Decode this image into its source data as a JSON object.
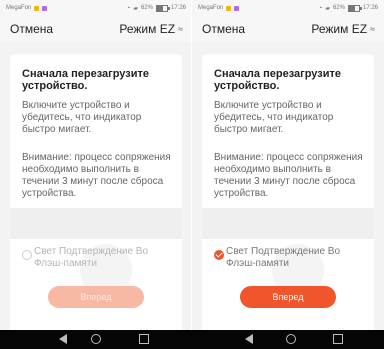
{
  "screens": [
    {
      "status": {
        "carrier": "MegaFon",
        "battery": "62%",
        "time": "17:26"
      },
      "header": {
        "cancel_label": "Отмена",
        "mode_label": "Режим EZ"
      },
      "card": {
        "title": "Сначала перезагрузите устройство.",
        "instruction": "Включите устройство и убедитесь, что индикатор быстро мигает.",
        "warning": "Внимание: процесс сопряжения необходимо выполнить в течении 3 минут после сброса устройства.",
        "confirm_label": "Свет Подтверждение Во Флэш-памяти",
        "confirm_checked": false,
        "next_label": "Вперед",
        "next_enabled": false
      }
    },
    {
      "status": {
        "carrier": "MegaFon",
        "battery": "62%",
        "time": "17:26"
      },
      "header": {
        "cancel_label": "Отмена",
        "mode_label": "Режим EZ"
      },
      "card": {
        "title": "Сначала перезагрузите устройство.",
        "instruction": "Включите устройство и убедитесь, что индикатор быстро мигает.",
        "warning": "Внимание: процесс сопряжения необходимо выполнить в течении 3 минут после сброса устройства.",
        "confirm_label": "Свет Подтверждение Во Флэш-памяти",
        "confirm_checked": true,
        "next_label": "Вперед",
        "next_enabled": true
      }
    }
  ],
  "icons": {
    "mode": "wave-icon",
    "wifi": "wifi-icon",
    "signal": "signal-icon",
    "battery": "battery-icon",
    "back": "back-icon",
    "home": "home-icon",
    "recent": "recent-apps-icon"
  },
  "colors": {
    "accent": "#f1552c",
    "accent_disabled": "#f7b9a4",
    "background": "#f3f3f3",
    "card": "#ffffff",
    "text_primary": "#222222",
    "text_secondary": "#666666",
    "nav_bar": "#050505"
  }
}
